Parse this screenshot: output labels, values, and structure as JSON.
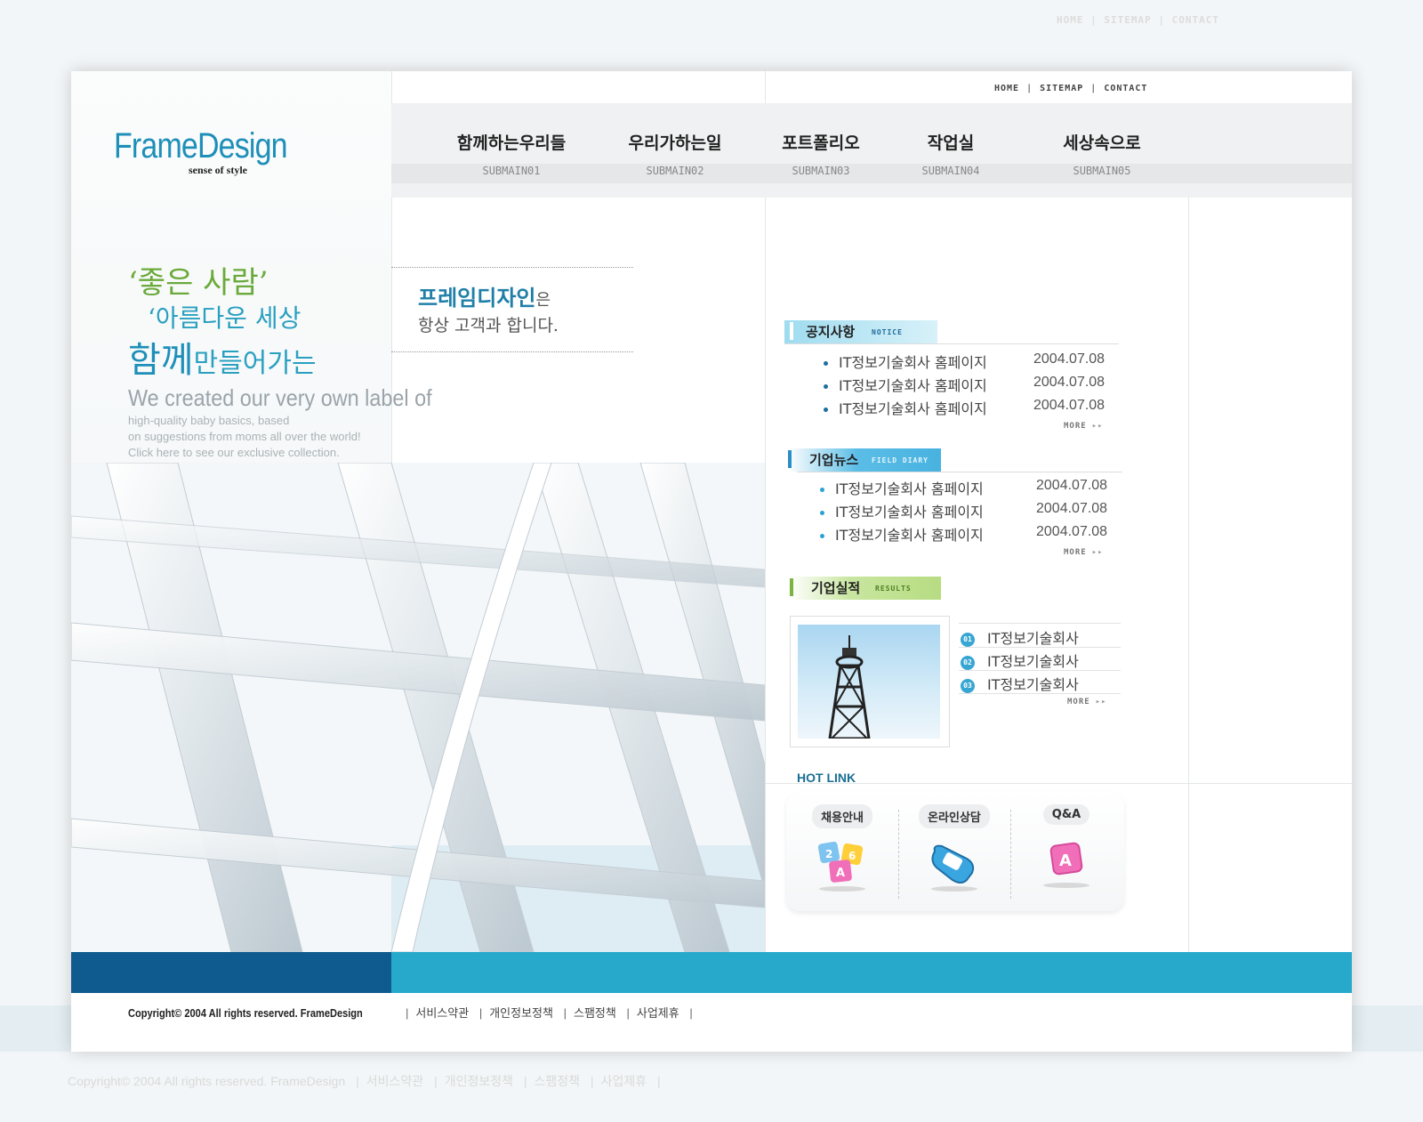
{
  "util_nav": [
    "HOME",
    "SITEMAP",
    "CONTACT"
  ],
  "logo": {
    "title": "FrameDesign",
    "subtitle": "sense of style"
  },
  "nav": [
    {
      "label": "함께하는우리들",
      "sub": "SUBMAIN01"
    },
    {
      "label": "우리가하는일",
      "sub": "SUBMAIN02"
    },
    {
      "label": "포트폴리오",
      "sub": "SUBMAIN03"
    },
    {
      "label": "작업실",
      "sub": "SUBMAIN04"
    },
    {
      "label": "세상속으로",
      "sub": "SUBMAIN05"
    }
  ],
  "hero": {
    "slogan_line1": "‘좋은 사람’",
    "slogan_line2": "‘아름다운 세상",
    "slogan_line3_a": "함께",
    "slogan_line3_b": "만들어가는",
    "en_title": "We created our very own label of",
    "en_body": [
      "high-quality baby basics, based",
      "on suggestions from moms all over the world!",
      "Click here to see our exclusive collection."
    ]
  },
  "tagline": {
    "line1_a": "프레임디자인",
    "line1_b": "은",
    "line2": "항상 고객과 합니다."
  },
  "notice": {
    "title": "공지사항",
    "en": "NOTICE",
    "items": [
      {
        "text": "IT정보기술회사 홈페이지",
        "date": "2004.07.08"
      },
      {
        "text": "IT정보기술회사 홈페이지",
        "date": "2004.07.08"
      },
      {
        "text": "IT정보기술회사 홈페이지",
        "date": "2004.07.08"
      }
    ],
    "more": "MORE"
  },
  "news": {
    "title": "기업뉴스",
    "en": "FIELD DIARY",
    "items": [
      {
        "text": "IT정보기술회사 홈페이지",
        "date": "2004.07.08"
      },
      {
        "text": "IT정보기술회사 홈페이지",
        "date": "2004.07.08"
      },
      {
        "text": "IT정보기술회사 홈페이지",
        "date": "2004.07.08"
      }
    ],
    "more": "MORE"
  },
  "results": {
    "title": "기업실적",
    "en": "RESULTS",
    "items": [
      {
        "num": "01",
        "text": "IT정보기술회사"
      },
      {
        "num": "02",
        "text": "IT정보기술회사"
      },
      {
        "num": "03",
        "text": "IT정보기술회사"
      }
    ],
    "more": "MORE"
  },
  "hotlink": {
    "title": "HOT LINK",
    "items": [
      {
        "label": "채용안내",
        "icon": "abc-blocks-icon"
      },
      {
        "label": "온라인상담",
        "icon": "phone-icon"
      },
      {
        "label": "Q&A",
        "icon": "qa-block-icon"
      }
    ]
  },
  "footer": {
    "copyright": "Copyright© 2004 All rights reserved. FrameDesign",
    "links": [
      "서비스약관",
      "개인정보정책",
      "스팸정책",
      "사업제휴"
    ]
  },
  "colors": {
    "brand_blue": "#1d8fb8",
    "brand_green": "#6aaa3a",
    "band_dark": "#0f5b8f",
    "band_light": "#27a9cc"
  }
}
